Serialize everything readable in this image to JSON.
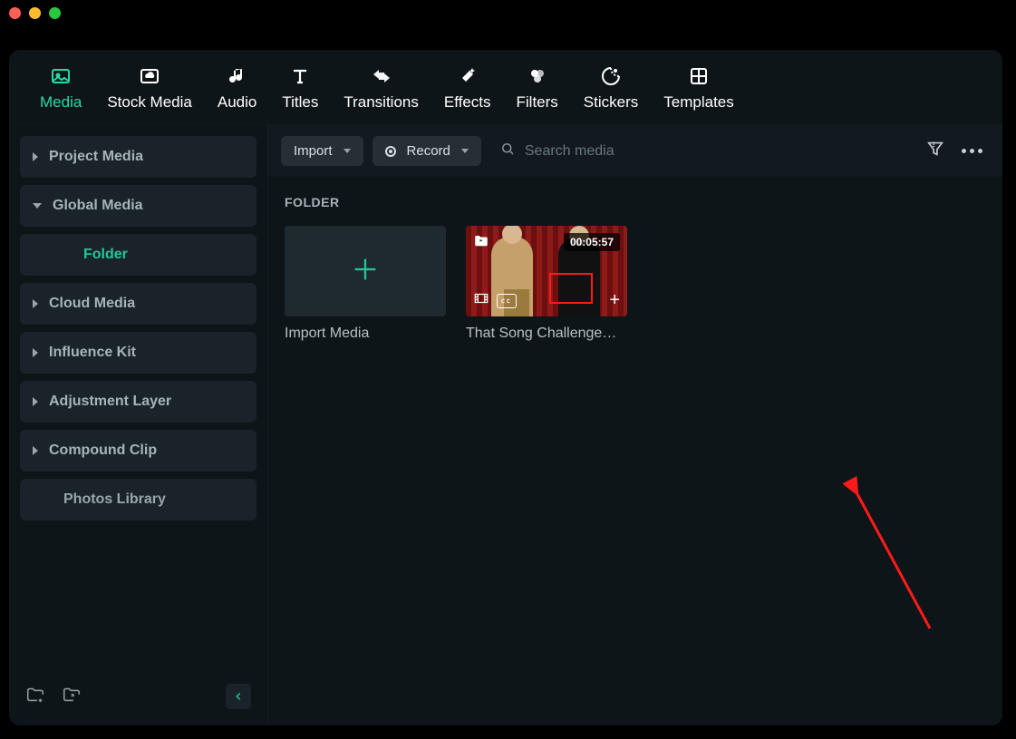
{
  "tabs": [
    {
      "label": "Media",
      "icon": "image"
    },
    {
      "label": "Stock Media",
      "icon": "cloud-image"
    },
    {
      "label": "Audio",
      "icon": "music"
    },
    {
      "label": "Titles",
      "icon": "text"
    },
    {
      "label": "Transitions",
      "icon": "swap"
    },
    {
      "label": "Effects",
      "icon": "sparkle"
    },
    {
      "label": "Filters",
      "icon": "circles"
    },
    {
      "label": "Stickers",
      "icon": "sticker"
    },
    {
      "label": "Templates",
      "icon": "grid"
    }
  ],
  "active_tab": 0,
  "sidebar": {
    "items": [
      {
        "label": "Project Media",
        "expanded": false,
        "type": "parent"
      },
      {
        "label": "Global Media",
        "expanded": true,
        "type": "parent"
      },
      {
        "label": "Folder",
        "type": "child",
        "active": true
      },
      {
        "label": "Cloud Media",
        "expanded": false,
        "type": "parent"
      },
      {
        "label": "Influence Kit",
        "expanded": false,
        "type": "parent"
      },
      {
        "label": "Adjustment Layer",
        "expanded": false,
        "type": "parent"
      },
      {
        "label": "Compound Clip",
        "expanded": false,
        "type": "parent"
      },
      {
        "label": "Photos Library",
        "type": "plain"
      }
    ]
  },
  "toolbar": {
    "import_label": "Import",
    "record_label": "Record",
    "search_placeholder": "Search media"
  },
  "section_title": "FOLDER",
  "media": {
    "import_label": "Import Media",
    "clip": {
      "label": "That Song Challenge…",
      "duration": "00:05:57"
    }
  }
}
